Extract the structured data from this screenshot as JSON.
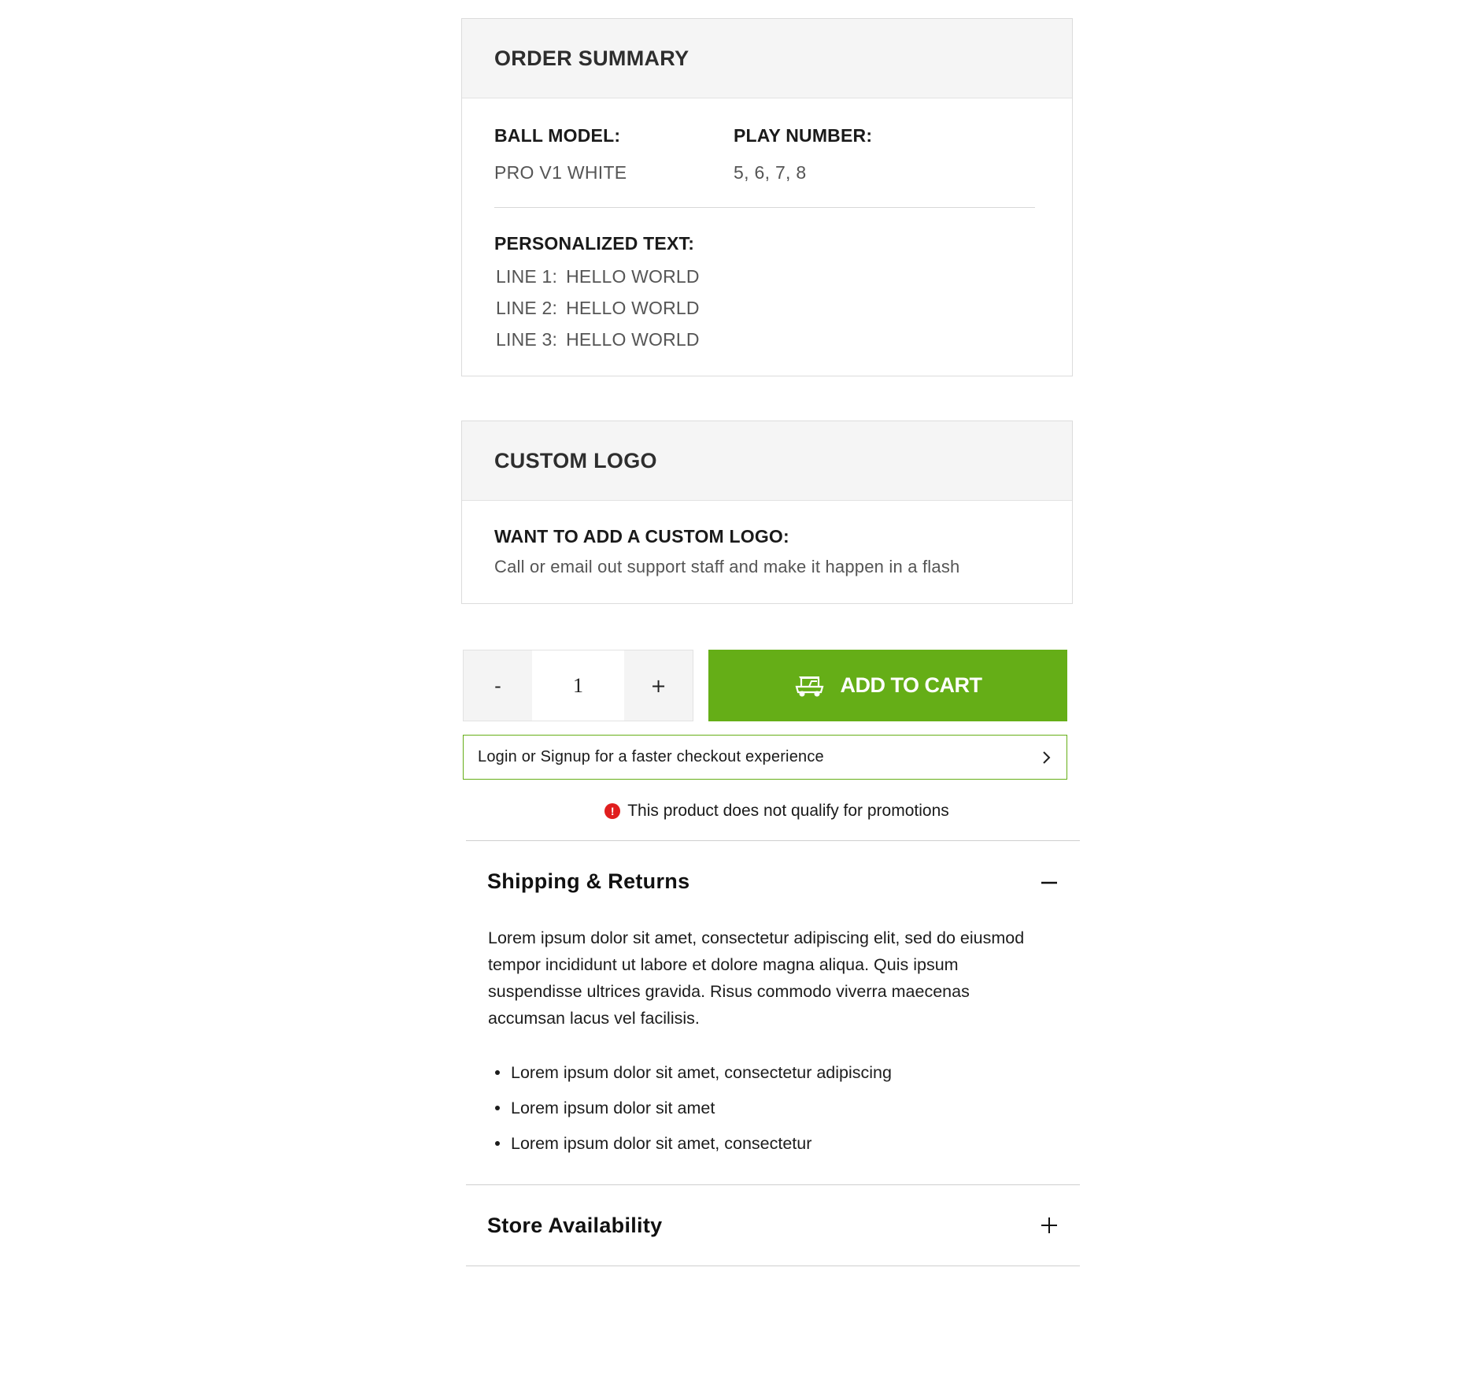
{
  "order_summary": {
    "title": "ORDER SUMMARY",
    "ball_model_label": "BALL MODEL:",
    "ball_model_value": "PRO V1 WHITE",
    "play_number_label": "PLAY NUMBER:",
    "play_number_value": "5, 6, 7, 8",
    "personalized_label": "PERSONALIZED TEXT:",
    "lines": [
      {
        "label": "LINE 1:",
        "value": "HELLO WORLD"
      },
      {
        "label": "LINE 2:",
        "value": "HELLO WORLD"
      },
      {
        "label": "LINE 3:",
        "value": "HELLO WORLD"
      }
    ]
  },
  "custom_logo": {
    "title": "CUSTOM LOGO",
    "question": "WANT TO ADD A CUSTOM LOGO:",
    "answer": "Call or email out support staff and make it happen in a flash"
  },
  "purchase": {
    "decrement_label": "-",
    "quantity": "1",
    "increment_label": "+",
    "add_to_cart_label": "ADD TO CART",
    "cart_icon": "golf-cart-icon",
    "accent_color": "#65ae17"
  },
  "login_prompt": {
    "text": "Login or Signup for a faster checkout experience",
    "icon": "chevron-right-icon"
  },
  "promo_notice": {
    "icon_glyph": "!",
    "text": "This product does not qualify for promotions",
    "icon_color": "#e01e1e"
  },
  "accordion": {
    "shipping": {
      "title": "Shipping & Returns",
      "state": "expanded",
      "paragraph": "Lorem ipsum dolor sit amet, consectetur adipiscing elit, sed do eiusmod tempor incididunt ut labore et dolore magna aliqua. Quis ipsum suspendisse ultrices gravida. Risus commodo viverra maecenas accumsan lacus vel facilisis.",
      "bullets": [
        "Lorem ipsum dolor sit amet, consectetur adipiscing",
        "Lorem ipsum dolor sit amet",
        "Lorem ipsum dolor sit amet, consectetur"
      ]
    },
    "store": {
      "title": "Store Availability",
      "state": "collapsed"
    }
  }
}
